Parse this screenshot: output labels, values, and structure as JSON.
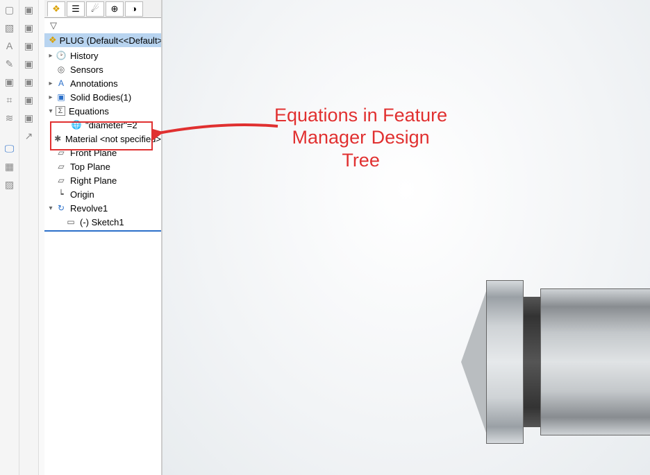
{
  "panel": {
    "part_label": "PLUG  (Default<<Default>_D",
    "tabs": [
      "feature-manager",
      "property-manager",
      "configuration-manager",
      "dimxpert",
      "display-manager"
    ]
  },
  "tree": {
    "history": "History",
    "sensors": "Sensors",
    "annotations": "Annotations",
    "solid_bodies": "Solid Bodies(1)",
    "equations": "Equations",
    "equation_items": [
      {
        "label": "\"diameter\"=2"
      }
    ],
    "material": "Material <not specified>",
    "front_plane": "Front Plane",
    "top_plane": "Top Plane",
    "right_plane": "Right Plane",
    "origin": "Origin",
    "revolve": "Revolve1",
    "sketch": "(-) Sketch1"
  },
  "callout": {
    "line1": "Equations in Feature",
    "line2": "Manager Design",
    "line3": "Tree"
  }
}
